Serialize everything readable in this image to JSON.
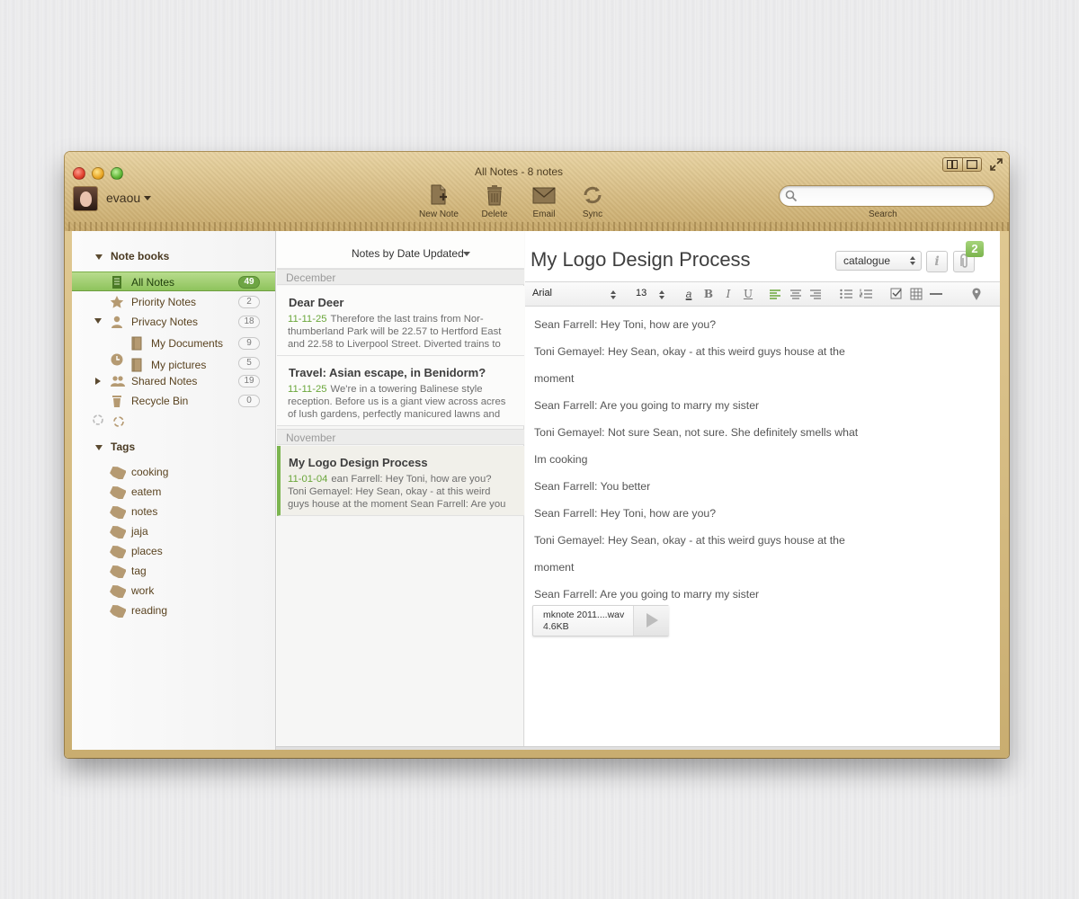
{
  "window": {
    "title": "All Notes - 8 notes"
  },
  "user": {
    "name": "evaou"
  },
  "toolbar": {
    "new_note": "New Note",
    "delete": "Delete",
    "email": "Email",
    "sync": "Sync"
  },
  "search": {
    "label": "Search",
    "placeholder": "",
    "value": ""
  },
  "sidebar": {
    "notebooks_header": "Note books",
    "notebooks": [
      {
        "label": "All Notes",
        "count": "49",
        "icon": "notes-icon",
        "selected": true
      },
      {
        "label": "Priority Notes",
        "count": "2",
        "icon": "star-icon"
      },
      {
        "label": "Privacy Notes",
        "count": "18",
        "icon": "person-icon",
        "expanded": true
      },
      {
        "label": "My Documents",
        "count": "9",
        "icon": "notebook-icon"
      },
      {
        "label": "My pictures",
        "count": "5",
        "icon": "notebook-icon"
      },
      {
        "label": "Shared Notes",
        "count": "19",
        "icon": "people-icon",
        "collapsed": true
      },
      {
        "label": "Recycle Bin",
        "count": "0",
        "icon": "trash-icon"
      }
    ],
    "tags_header": "Tags",
    "tags": [
      "cooking",
      "eatem",
      "notes",
      "jaja",
      "places",
      "tag",
      "work",
      "reading"
    ]
  },
  "note_list": {
    "sort_label": "Notes by Date Updated",
    "months": [
      "December",
      "November"
    ],
    "notes": [
      {
        "title": "Dear Deer",
        "date": "11-11-25",
        "snippet": "Therefore the last trains from Nor-thumberland Park will be 22.57 to Hertford East and 22.58 to Liverpool Street. Diverted trains to"
      },
      {
        "title": "Travel: Asian escape, in Benidorm?",
        "date": "11-11-25",
        "snippet": "We're in a towering Balinese style reception. Before us is a giant view across acres of lush gardens, perfectly manicured lawns and"
      },
      {
        "title": "My  Logo Design Process",
        "date": "11-01-04",
        "snippet": "ean Farrell:  Hey Toni, how are you? Toni Gemayel:  Hey Sean, okay - at this weird guys house at the moment Sean Farrell:  Are you",
        "selected": true
      }
    ]
  },
  "editor": {
    "title": "My Logo Design Process",
    "notebook_select": "catalogue",
    "attachment_count": "2",
    "font_family": "Arial",
    "font_size": "13",
    "lines": [
      "Sean Farrell:  Hey Toni, how are you?",
      "Toni Gemayel:  Hey Sean, okay - at this weird guys house at the",
      "moment",
      "Sean Farrell:  Are you going to marry my sister",
      "Toni Gemayel:  Not sure Sean, not sure.  She definitely smells what",
      "Im cooking",
      "Sean Farrell:  You better",
      "Sean Farrell:  Hey Toni, how are you?",
      "Toni Gemayel:  Hey Sean, okay - at this weird guys house at the",
      "moment",
      "Sean Farrell:  Are you going to marry my sister"
    ],
    "attachment": {
      "name": "mknote 2011....wav",
      "size": "4.6KB"
    }
  },
  "colors": {
    "accent_green": "#8ec35c",
    "date_green": "#6aa63a",
    "toolbar_tan": "#d2b67b"
  }
}
